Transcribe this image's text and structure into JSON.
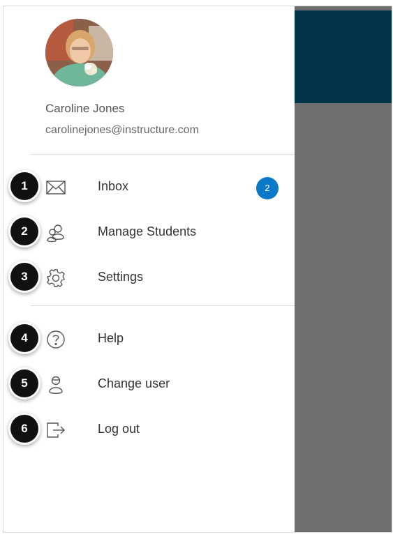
{
  "user": {
    "name": "Caroline Jones",
    "email": "carolinejones@instructure.com"
  },
  "menu": {
    "inbox": {
      "label": "Inbox",
      "icon": "mail-icon",
      "badge": "2",
      "step": "1"
    },
    "manage_students": {
      "label": "Manage Students",
      "icon": "users-icon",
      "step": "2"
    },
    "settings": {
      "label": "Settings",
      "icon": "gear-icon",
      "step": "3"
    },
    "help": {
      "label": "Help",
      "icon": "help-icon",
      "step": "4"
    },
    "change_user": {
      "label": "Change user",
      "icon": "change-user-icon",
      "step": "5"
    },
    "log_out": {
      "label": "Log out",
      "icon": "logout-icon",
      "step": "6"
    }
  },
  "colors": {
    "badge": "#0a79c8",
    "header_dark": "#033349",
    "overlay_gray": "#6e6e6e",
    "step_callout": "#111111"
  }
}
